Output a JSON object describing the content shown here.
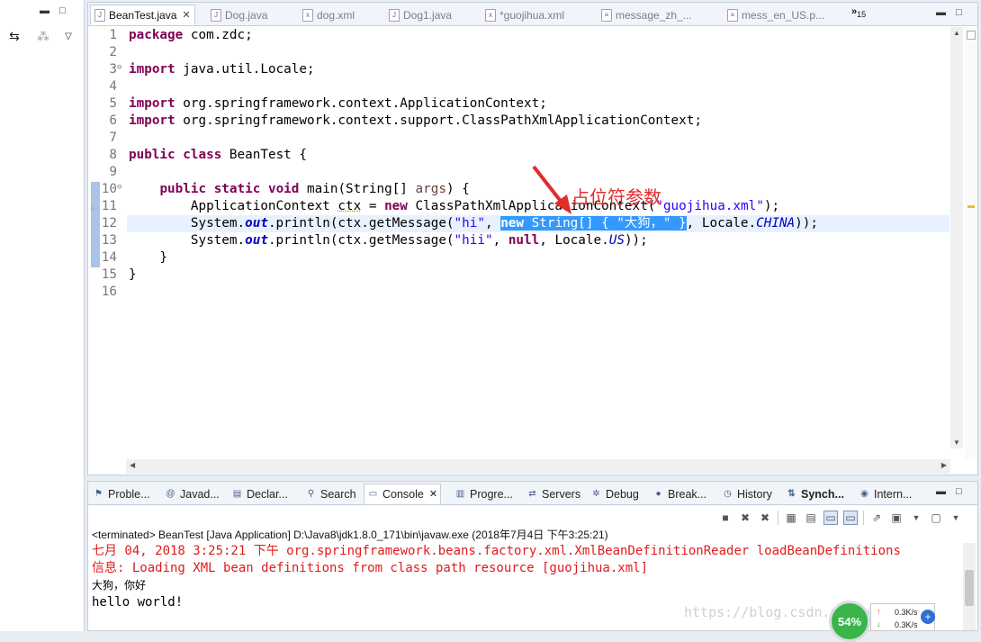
{
  "editor": {
    "tabs": [
      {
        "label": "BeanTest.java",
        "active": true,
        "icon": "java-file-icon"
      },
      {
        "label": "Dog.java",
        "active": false,
        "icon": "java-file-icon"
      },
      {
        "label": "dog.xml",
        "active": false,
        "icon": "xml-file-icon"
      },
      {
        "label": "Dog1.java",
        "active": false,
        "icon": "java-file-icon"
      },
      {
        "label": "*guojihua.xml",
        "active": false,
        "icon": "xml-file-icon"
      },
      {
        "label": "message_zh_...",
        "active": false,
        "icon": "properties-file-icon"
      },
      {
        "label": "mess_en_US.p...",
        "active": false,
        "icon": "properties-file-icon"
      }
    ],
    "overflow_label": "»",
    "overflow_count": "15",
    "line_numbers": [
      "1",
      "2",
      "3",
      "4",
      "5",
      "6",
      "7",
      "8",
      "9",
      "10",
      "11",
      "12",
      "13",
      "14",
      "15",
      "16"
    ],
    "code": {
      "l1_kw": "package",
      "l1_rest": " com.zdc;",
      "l3_kw": "import",
      "l3_rest": " java.util.Locale;",
      "l5_kw": "import",
      "l5_rest": " org.springframework.context.ApplicationContext;",
      "l6_kw": "import",
      "l6_rest": " org.springframework.context.support.ClassPathXmlApplicationContext;",
      "l8_kw1": "public",
      "l8_kw2": "class",
      "l8_rest": " BeanTest {",
      "l10_indent": "    ",
      "l10_kw1": "public",
      "l10_kw2": "static",
      "l10_kw3": "void",
      "l10_mid": " main(String[] ",
      "l10_param": "args",
      "l10_end": ") {",
      "l11_pre": "        ApplicationContext ",
      "l11_var": "ctx",
      "l11_eq": " = ",
      "l11_kw": "new",
      "l11_mid": " ClassPathXmlApplicationContext(",
      "l11_str": "\"guojihua.xml\"",
      "l11_end": ");",
      "l12_pre": "        System.",
      "l12_field": "out",
      "l12_mid": ".println(ctx.getMessage(",
      "l12_str": "\"hi\"",
      "l12_comma": ", ",
      "l12_sel_kw": "new",
      "l12_sel_rest": " String[] { \"大狗，\" }",
      "l12_after": ", Locale.",
      "l12_const": "CHINA",
      "l12_end": "));",
      "l13_pre": "        System.",
      "l13_field": "out",
      "l13_mid": ".println(ctx.getMessage(",
      "l13_str": "\"hii\"",
      "l13_comma": ", ",
      "l13_kw": "null",
      "l13_after": ", Locale.",
      "l13_const": "US",
      "l13_end": "));",
      "l14": "    }",
      "l15": "}"
    },
    "annotation_label": "占位符参数",
    "annotation_color": "#e22b2b"
  },
  "views": {
    "tabs": [
      {
        "label": "Proble...",
        "icon": "problems-icon"
      },
      {
        "label": "Javad...",
        "icon": "javadoc-icon"
      },
      {
        "label": "Declar...",
        "icon": "declaration-icon"
      },
      {
        "label": "Search",
        "icon": "search-icon"
      },
      {
        "label": "Console",
        "icon": "console-icon",
        "active": true
      },
      {
        "label": "Progre...",
        "icon": "progress-icon"
      },
      {
        "label": "Servers",
        "icon": "servers-icon"
      },
      {
        "label": "Debug",
        "icon": "debug-icon"
      },
      {
        "label": "Break...",
        "icon": "breakpoints-icon"
      },
      {
        "label": "History",
        "icon": "history-icon"
      },
      {
        "label": "Synch...",
        "icon": "synchronize-icon",
        "bold": true
      },
      {
        "label": "Intern...",
        "icon": "internal-web-browser-icon"
      }
    ],
    "console_status": "<terminated> BeanTest [Java Application] D:\\Java8\\jdk1.8.0_171\\bin\\javaw.exe (2018年7月4日 下午3:25:21)",
    "console_lines": [
      "七月 04, 2018 3:25:21 下午 org.springframework.beans.factory.xml.XmlBeanDefinitionReader loadBeanDefinitions",
      "信息: Loading XML bean definitions from class path resource [guojihua.xml]",
      "大狗，你好",
      "hello world!"
    ],
    "error_color": "#e01b1b"
  },
  "watermark": "https://blog.csdn.net/u0156465",
  "net_widget": {
    "percent": "54%",
    "up_rate": "0.3K/s",
    "down_rate": "0.3K/s",
    "plus": "+"
  }
}
